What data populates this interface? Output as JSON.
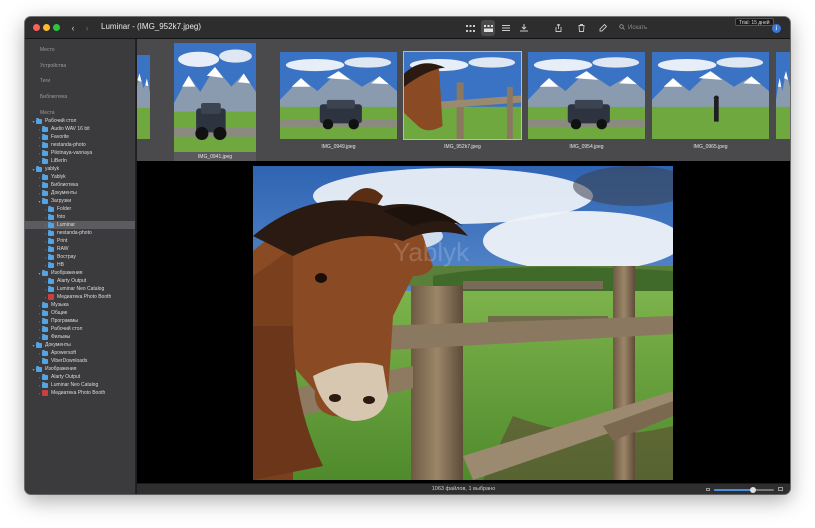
{
  "window": {
    "title": "Luminar - (IMG_952k7.jpeg)",
    "trial_badge": "Trial: 15 дней",
    "search_placeholder": "Искать"
  },
  "sidebar": {
    "sections": [
      "Место",
      "Устройства",
      "Теги",
      "Библиотека",
      "Места"
    ],
    "tree": [
      {
        "label": "Рабочий стол",
        "depth": 0,
        "expanded": true,
        "icon": "folder"
      },
      {
        "label": "Audio WAV 16 bit",
        "depth": 1,
        "icon": "folder"
      },
      {
        "label": "Favorite",
        "depth": 1,
        "icon": "folder"
      },
      {
        "label": "nestanda-photo",
        "depth": 1,
        "icon": "folder"
      },
      {
        "label": "Pilotnaya-vannaya",
        "depth": 1,
        "icon": "folder"
      },
      {
        "label": "LiBerIn",
        "depth": 1,
        "icon": "folder"
      },
      {
        "label": "yablyk",
        "depth": 0,
        "expanded": true,
        "icon": "folder"
      },
      {
        "label": "Yablyk",
        "depth": 1,
        "icon": "folder"
      },
      {
        "label": "Библиотека",
        "depth": 1,
        "icon": "folder"
      },
      {
        "label": "Документы",
        "depth": 1,
        "icon": "folder"
      },
      {
        "label": "Загрузки",
        "depth": 1,
        "expanded": true,
        "icon": "folder"
      },
      {
        "label": "Folder",
        "depth": 2,
        "icon": "folder"
      },
      {
        "label": "foto",
        "depth": 2,
        "icon": "folder"
      },
      {
        "label": "Luminar",
        "depth": 2,
        "icon": "folder",
        "selected": true
      },
      {
        "label": "nestanda-photo",
        "depth": 2,
        "icon": "folder"
      },
      {
        "label": "Print",
        "depth": 2,
        "icon": "folder"
      },
      {
        "label": "RAW",
        "depth": 2,
        "icon": "folder"
      },
      {
        "label": "Вострау",
        "depth": 2,
        "icon": "folder"
      },
      {
        "label": "HB",
        "depth": 2,
        "icon": "folder"
      },
      {
        "label": "Изображения",
        "depth": 1,
        "expanded": true,
        "icon": "folder"
      },
      {
        "label": "Alarty Output",
        "depth": 2,
        "icon": "folder"
      },
      {
        "label": "Luminar Neo Catalog",
        "depth": 2,
        "icon": "folder"
      },
      {
        "label": "Медиатека Photo Booth",
        "depth": 2,
        "icon": "app"
      },
      {
        "label": "Музыка",
        "depth": 1,
        "icon": "folder"
      },
      {
        "label": "Общие",
        "depth": 1,
        "icon": "folder"
      },
      {
        "label": "Программы",
        "depth": 1,
        "icon": "folder"
      },
      {
        "label": "Рабочий стол",
        "depth": 1,
        "icon": "folder"
      },
      {
        "label": "Фильмы",
        "depth": 1,
        "icon": "folder"
      },
      {
        "label": "Документы",
        "depth": 0,
        "expanded": true,
        "icon": "folder"
      },
      {
        "label": "Apowersoft",
        "depth": 1,
        "icon": "folder"
      },
      {
        "label": "ViberDownloads",
        "depth": 1,
        "icon": "folder"
      },
      {
        "label": "Изображения",
        "depth": 0,
        "expanded": true,
        "icon": "folder"
      },
      {
        "label": "Alarty Output",
        "depth": 1,
        "icon": "folder"
      },
      {
        "label": "Luminar Neo Catalog",
        "depth": 1,
        "icon": "folder"
      },
      {
        "label": "Медиатека Photo Booth",
        "depth": 1,
        "icon": "app"
      }
    ]
  },
  "thumbnails": [
    {
      "caption": "",
      "scene": "mountain-partial"
    },
    {
      "caption": "IMG_0941.jpeg",
      "scene": "mountain-car-tall",
      "hovered": true
    },
    {
      "caption": "IMG_0949.jpeg",
      "scene": "mountain-car"
    },
    {
      "caption": "IMG_952k7.jpeg",
      "scene": "horse",
      "selected": true
    },
    {
      "caption": "IMG_0954.jpeg",
      "scene": "mountain-car2"
    },
    {
      "caption": "IMG_0965.jpeg",
      "scene": "mountain-person"
    },
    {
      "caption": "",
      "scene": "partial-right"
    }
  ],
  "status": {
    "text": "1063 файлов, 1 выбрано",
    "zoom_level": 0.65
  },
  "colors": {
    "accent": "#4a8fe0",
    "folder": "#54a3e3",
    "sky": "#3b73c4",
    "grass": "#6ea83e"
  }
}
